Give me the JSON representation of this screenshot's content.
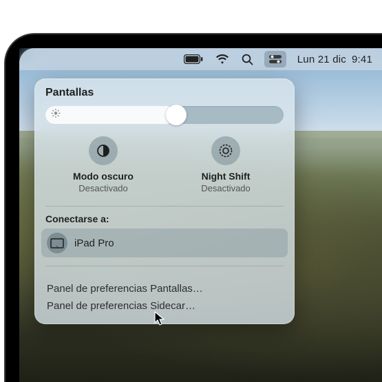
{
  "menubar": {
    "date_label": "Lun 21 dic",
    "time_label": "9:41"
  },
  "panel": {
    "title": "Pantallas",
    "brightness_percent": 55,
    "toggles": [
      {
        "label": "Modo oscuro",
        "state": "Desactivado"
      },
      {
        "label": "Night Shift",
        "state": "Desactivado"
      }
    ],
    "connect_label": "Conectarse a:",
    "connect_items": [
      {
        "name": "iPad Pro"
      }
    ],
    "pref_links": [
      "Panel de preferencias Pantallas…",
      "Panel de preferencias Sidecar…"
    ]
  }
}
